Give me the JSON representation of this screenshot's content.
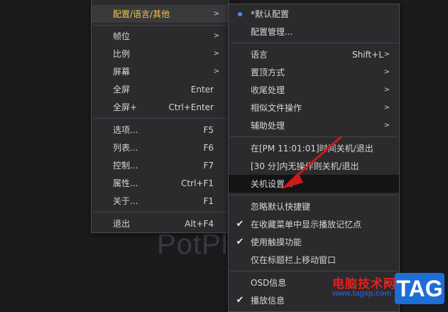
{
  "background_watermark": "PotPl",
  "main_menu": {
    "items": [
      {
        "label": "配置/语言/其他",
        "shortcut": "",
        "submenu": true
      },
      {
        "label": "帧位",
        "shortcut": "",
        "submenu": true
      },
      {
        "label": "比例",
        "shortcut": "",
        "submenu": true
      },
      {
        "label": "屏幕",
        "shortcut": "",
        "submenu": true
      },
      {
        "label": "全屏",
        "shortcut": "Enter",
        "submenu": false
      },
      {
        "label": "全屏+",
        "shortcut": "Ctrl+Enter",
        "submenu": false
      },
      {
        "label": "选项...",
        "shortcut": "F5",
        "submenu": false
      },
      {
        "label": "列表...",
        "shortcut": "F6",
        "submenu": false
      },
      {
        "label": "控制...",
        "shortcut": "F7",
        "submenu": false
      },
      {
        "label": "属性...",
        "shortcut": "Ctrl+F1",
        "submenu": false
      },
      {
        "label": "关于...",
        "shortcut": "F1",
        "submenu": false
      },
      {
        "label": "退出",
        "shortcut": "Alt+F4",
        "submenu": false
      }
    ]
  },
  "sub_menu": {
    "items": [
      {
        "label": "*默认配置",
        "shortcut": "",
        "mark": "radio"
      },
      {
        "label": "配置管理...",
        "shortcut": "",
        "mark": ""
      },
      {
        "label": "语言",
        "shortcut": "Shift+L",
        "submenu": true,
        "mark": ""
      },
      {
        "label": "置顶方式",
        "shortcut": "",
        "submenu": true,
        "mark": ""
      },
      {
        "label": "收尾处理",
        "shortcut": "",
        "submenu": true,
        "mark": ""
      },
      {
        "label": "相似文件操作",
        "shortcut": "",
        "submenu": true,
        "mark": ""
      },
      {
        "label": "辅助处理",
        "shortcut": "",
        "submenu": true,
        "mark": ""
      },
      {
        "label": "在[PM 11:01:01]时间关机/退出",
        "shortcut": "",
        "mark": ""
      },
      {
        "label": "[30 分]内无操作则关机/退出",
        "shortcut": "",
        "mark": ""
      },
      {
        "label": "关机设置...",
        "shortcut": "",
        "mark": ""
      },
      {
        "label": "忽略默认快捷键",
        "shortcut": "",
        "mark": ""
      },
      {
        "label": "在收藏菜单中显示播放记忆点",
        "shortcut": "",
        "mark": "check"
      },
      {
        "label": "使用触摸功能",
        "shortcut": "",
        "mark": "check"
      },
      {
        "label": "仅在标题栏上移动窗口",
        "shortcut": "",
        "mark": ""
      },
      {
        "label": "OSD信息",
        "shortcut": "",
        "submenu": true,
        "mark": ""
      },
      {
        "label": "播放信息",
        "shortcut": "",
        "mark": "check"
      }
    ]
  },
  "overlay": {
    "site_name": "电脑技术网",
    "site_url": "www.tagxp.com",
    "tag": "TAG"
  },
  "colors": {
    "active_label": "#f2c84b",
    "radio_dot": "#4e8cf0",
    "annotation_arrow": "#d01818"
  }
}
